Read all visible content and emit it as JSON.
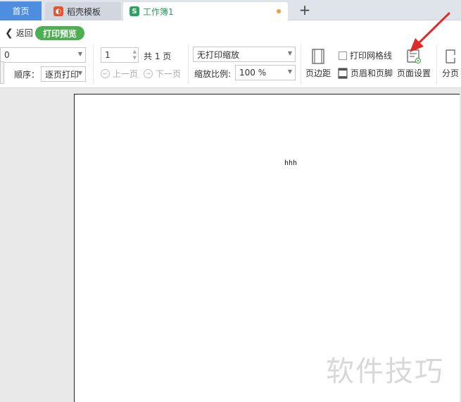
{
  "tabs": [
    {
      "label": "首页"
    },
    {
      "label": "稻壳模板"
    },
    {
      "label": "工作簿1"
    }
  ],
  "add_tab": "+",
  "toolbar": {
    "back": "返回",
    "mode_badge": "打印预览",
    "printer_value": "0",
    "order_label": "顺序：",
    "order_value": "逐页打印",
    "page_number": "1",
    "total_pages": "共 1 页",
    "prev_page": "上一页",
    "next_page": "下一页",
    "scaling_value": "无打印缩放",
    "zoom_label": "缩放比例:",
    "zoom_value": "100 %",
    "margins": "页边距",
    "gridlines": "打印网格线",
    "header_footer": "页眉和页脚",
    "page_setup": "页面设置",
    "page_break": "分页"
  },
  "sheet": {
    "cell_text": "hhh"
  },
  "watermark": "软件技巧",
  "colors": {
    "accent_green": "#4caf50",
    "home_tab": "#4e8ee0",
    "arrow_red": "#e02a2a"
  }
}
